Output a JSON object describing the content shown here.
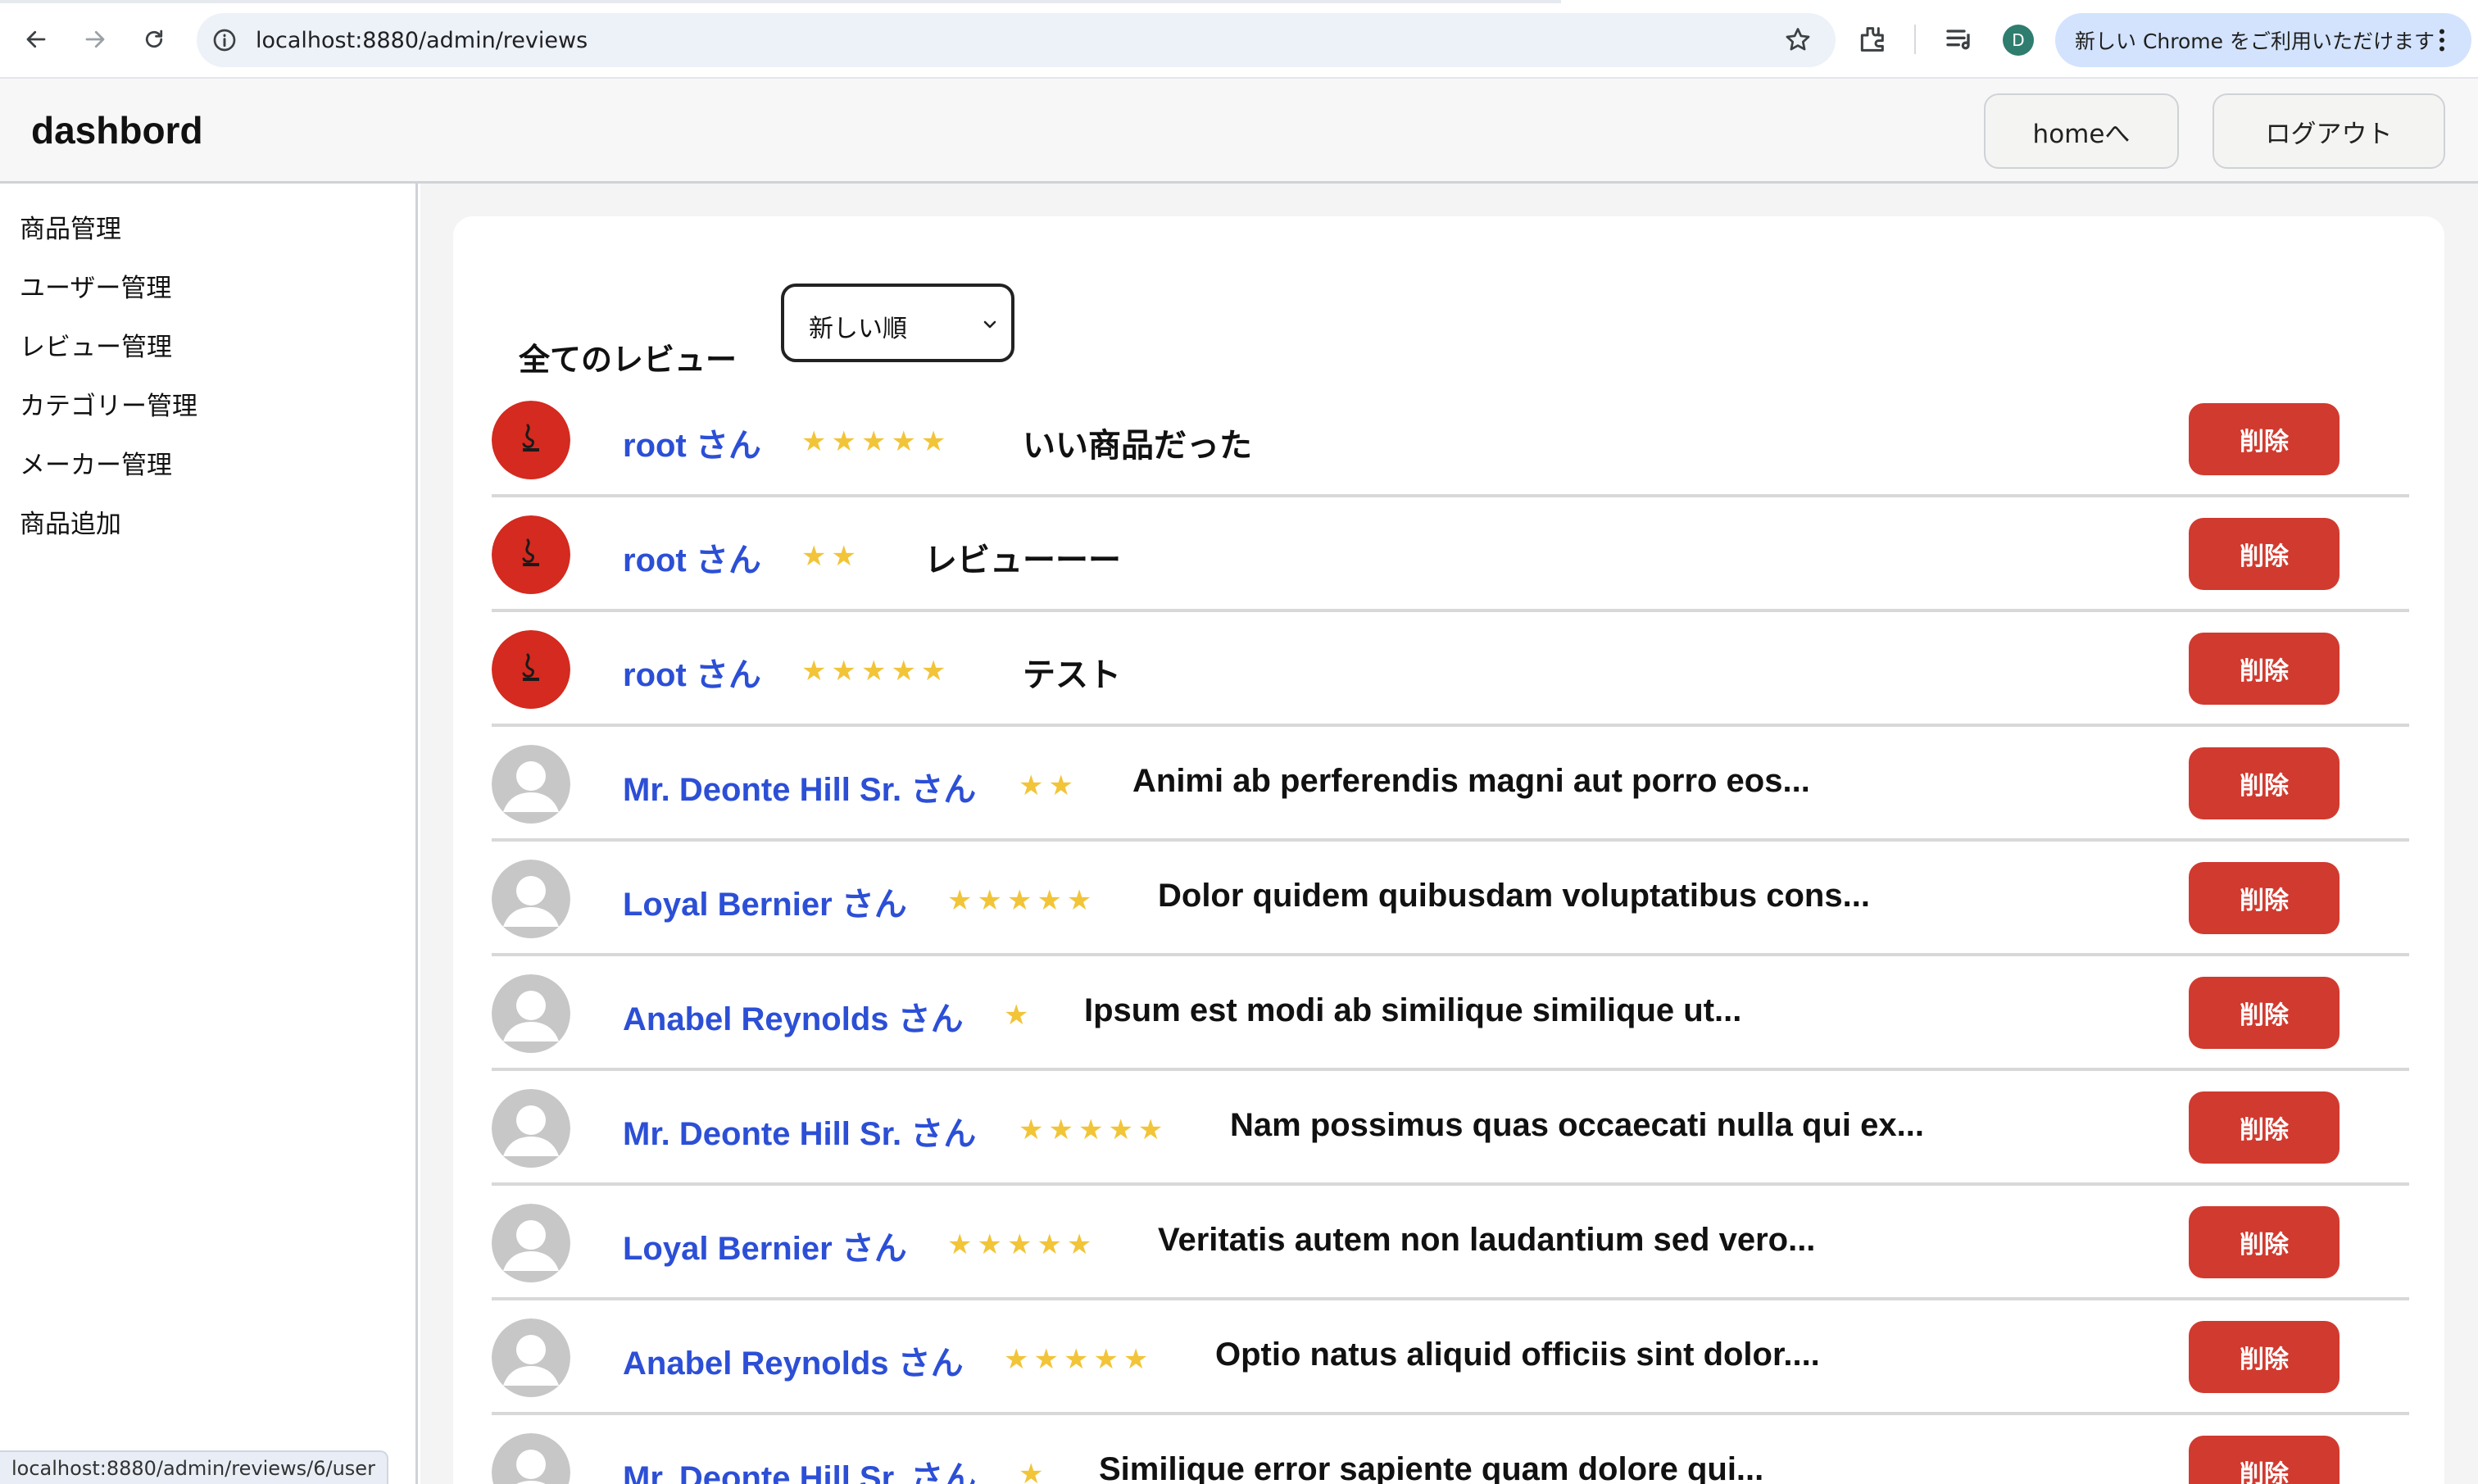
{
  "browser": {
    "url": "localhost:8880/admin/reviews",
    "update_chip": "新しい Chrome をご利用いただけます",
    "profile_initial": "D",
    "load_progress": 0.63
  },
  "header": {
    "brand": "dashbord",
    "home_button": "homeへ",
    "logout_button": "ログアウト"
  },
  "sidebar": {
    "items": [
      {
        "label": "商品管理"
      },
      {
        "label": "ユーザー管理"
      },
      {
        "label": "レビュー管理"
      },
      {
        "label": "カテゴリー管理"
      },
      {
        "label": "メーカー管理"
      },
      {
        "label": "商品追加"
      }
    ]
  },
  "main": {
    "title": "全てのレビュー",
    "sort_selected": "新しい順",
    "delete_label": "削除",
    "reviews": [
      {
        "user": "root さん",
        "stars": 5,
        "text": "いい商品だった",
        "avatar": "custom"
      },
      {
        "user": "root さん",
        "stars": 2,
        "text": "レビューーー",
        "avatar": "custom"
      },
      {
        "user": "root さん",
        "stars": 5,
        "text": "テスト",
        "avatar": "custom"
      },
      {
        "user": "Mr. Deonte Hill Sr. さん",
        "stars": 2,
        "text": "Animi ab perferendis magni aut porro eos...",
        "avatar": "default"
      },
      {
        "user": "Loyal Bernier さん",
        "stars": 5,
        "text": "Dolor quidem quibusdam voluptatibus cons...",
        "avatar": "default"
      },
      {
        "user": "Anabel Reynolds さん",
        "stars": 1,
        "text": "Ipsum est modi ab similique similique ut...",
        "avatar": "default"
      },
      {
        "user": "Mr. Deonte Hill Sr. さん",
        "stars": 5,
        "text": "Nam possimus quas occaecati nulla qui ex...",
        "avatar": "default"
      },
      {
        "user": "Loyal Bernier さん",
        "stars": 5,
        "text": "Veritatis autem non laudantium sed vero...",
        "avatar": "default"
      },
      {
        "user": "Anabel Reynolds さん",
        "stars": 5,
        "text": "Optio natus aliquid officiis sint dolor....",
        "avatar": "default"
      },
      {
        "user": "Mr. Deonte Hill Sr. さん",
        "stars": 1,
        "text": "Similique error sapiente quam dolore qui...",
        "avatar": "default"
      }
    ]
  },
  "status_bar": "localhost:8880/admin/reviews/6/user",
  "colors": {
    "user_name": "#2c4fd6",
    "star": "#f2c438",
    "delete_button": "#d13a2f",
    "custom_avatar_bg": "#d42a1f"
  }
}
